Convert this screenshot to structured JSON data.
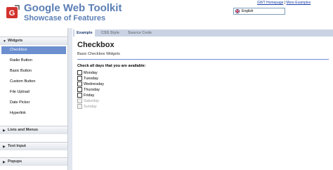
{
  "header": {
    "title": "Google Web Toolkit",
    "subtitle": "Showcase of Features",
    "links": [
      "GWT Homepage",
      "More Examples"
    ],
    "language": {
      "selected": "English"
    },
    "colors": {
      "title": "#5b7fb5",
      "logo": "#d2322d"
    }
  },
  "sidebar": {
    "sections": [
      {
        "label": "Widgets",
        "expanded": true,
        "items": [
          {
            "label": "Checkbox",
            "selected": true
          },
          {
            "label": "Radio Button",
            "selected": false
          },
          {
            "label": "Basic Button",
            "selected": false
          },
          {
            "label": "Custom Button",
            "selected": false
          },
          {
            "label": "File Upload",
            "selected": false
          },
          {
            "label": "Date Picker",
            "selected": false
          },
          {
            "label": "Hyperlink",
            "selected": false
          }
        ]
      },
      {
        "label": "Lists and Menus",
        "expanded": false
      },
      {
        "label": "Text Input",
        "expanded": false
      },
      {
        "label": "Popups",
        "expanded": false
      }
    ],
    "selected_color": "#6b8fcf"
  },
  "tabs": [
    {
      "label": "Example",
      "active": true
    },
    {
      "label": "CSS Style",
      "active": false
    },
    {
      "label": "Source Code",
      "active": false
    }
  ],
  "main": {
    "title": "Checkbox",
    "description": "Basic Checkbox Widgets",
    "question": "Check all days that you are available:",
    "days": [
      {
        "label": "Monday",
        "enabled": true,
        "checked": false
      },
      {
        "label": "Tuesday",
        "enabled": true,
        "checked": false
      },
      {
        "label": "Wednesday",
        "enabled": true,
        "checked": false
      },
      {
        "label": "Thursday",
        "enabled": true,
        "checked": false
      },
      {
        "label": "Friday",
        "enabled": true,
        "checked": false
      },
      {
        "label": "Saturday",
        "enabled": false,
        "checked": false
      },
      {
        "label": "Sunday",
        "enabled": false,
        "checked": false
      }
    ]
  }
}
